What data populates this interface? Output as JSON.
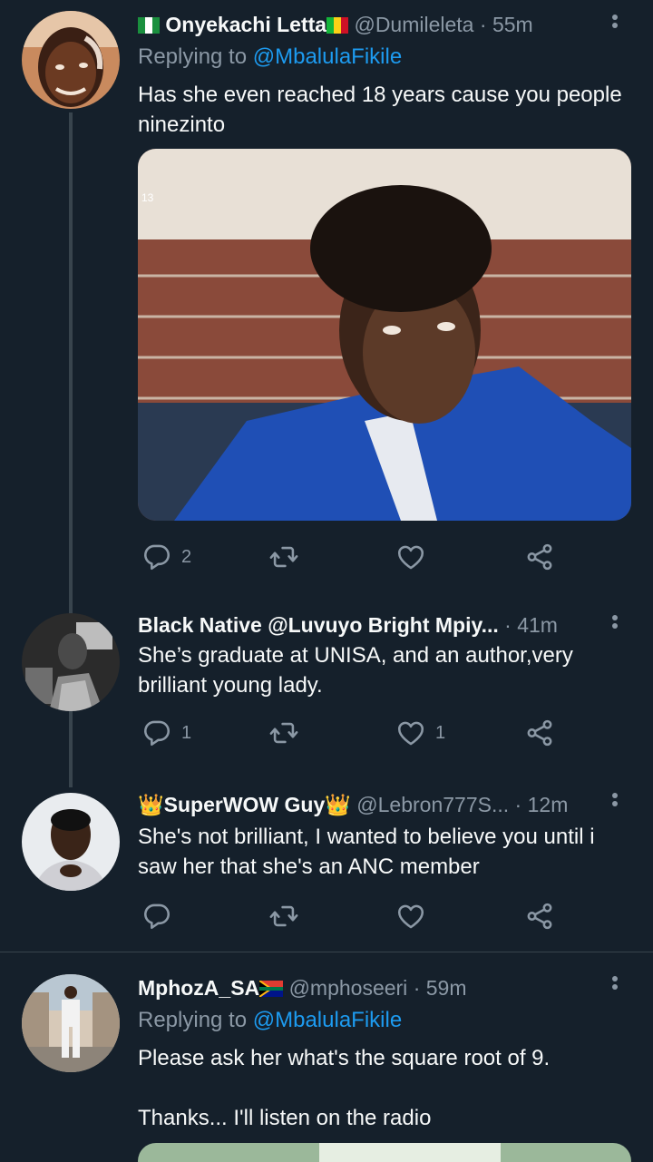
{
  "tweets": [
    {
      "name": "Onyekachi Letta",
      "handle": "@Dumileleta",
      "dot": "·",
      "time": "55m",
      "replying_prefix": "Replying to",
      "replying_to": "@MbalulaFikile",
      "text": "Has she even reached 18 years cause you people ninezinto",
      "replies": "2",
      "retweets": "",
      "likes": ""
    },
    {
      "name": "Black Native @Luvuyo Bright Mpiy...",
      "handle": "",
      "dot": "·",
      "time": "41m",
      "text": "She’s graduate at UNISA, and an author,very brilliant young lady.",
      "replies": "1",
      "retweets": "",
      "likes": "1"
    },
    {
      "name": "SuperWOW Guy",
      "handle": "@Lebron777S...",
      "dot": "·",
      "time": "12m",
      "text": "She's not brilliant, I wanted to believe you until i saw her that she's an ANC member",
      "replies": "",
      "retweets": "",
      "likes": ""
    },
    {
      "name": "MphozA_SA",
      "handle": "@mphoseeri",
      "dot": "·",
      "time": "59m",
      "replying_prefix": "Replying to",
      "replying_to": "@MbalulaFikile",
      "text_line1": "Please ask her what's the square root of 9.",
      "text_line2": "Thanks... I'll listen on the radio"
    }
  ],
  "emoji": {
    "crown": "👑"
  },
  "colors": {
    "background": "#15202b",
    "secondary_text": "#8b98a5",
    "accent": "#1d9bf0",
    "divider": "#38444d"
  },
  "icons": [
    "reply-icon",
    "retweet-icon",
    "like-icon",
    "share-icon",
    "more-icon"
  ]
}
